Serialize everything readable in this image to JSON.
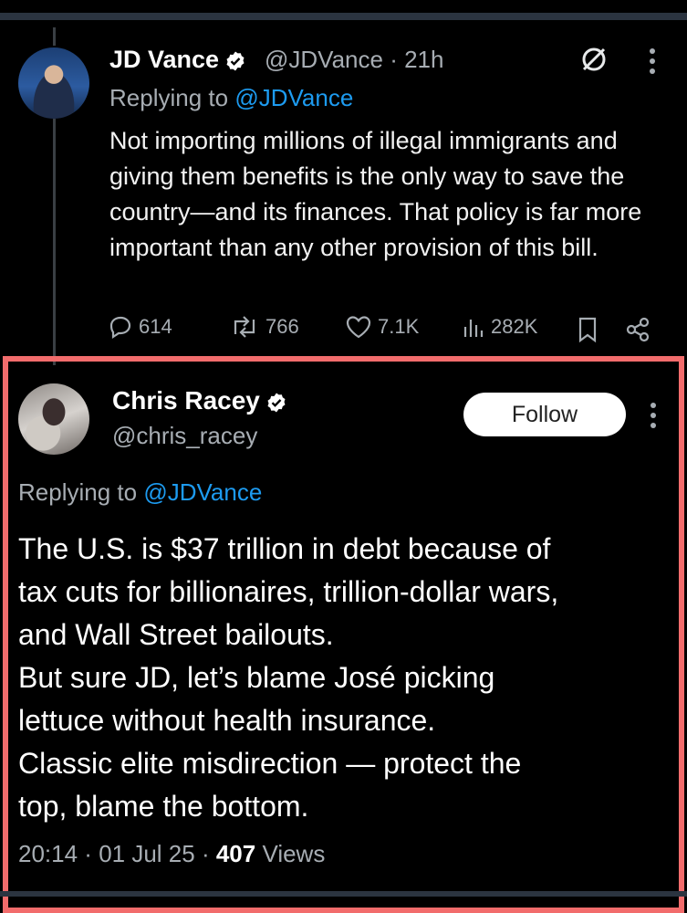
{
  "tweet1": {
    "name": "JD Vance",
    "handle": "@JDVance",
    "separator": " · ",
    "time": "21h",
    "replying_prefix": "Replying to ",
    "replying_to": "@JDVance",
    "text": "Not importing millions of illegal immigrants and giving them benefits is the only way to save the country—and its finances. That policy is far more important than any other provision of this bill.",
    "stats": {
      "replies": "614",
      "reposts": "766",
      "likes": "7.1K",
      "views": "282K"
    }
  },
  "tweet2": {
    "name": "Chris Racey",
    "handle": "@chris_racey",
    "follow_label": "Follow",
    "replying_prefix": "Replying to ",
    "replying_to": "@JDVance",
    "lines": [
      "The U.S. is $37 trillion in debt because of",
      "tax cuts for billionaires, trillion-dollar wars,",
      "and Wall Street bailouts.",
      "But sure JD, let’s blame José picking",
      "lettuce without health insurance.",
      "Classic elite misdirection — protect the",
      "top, blame the bottom."
    ],
    "time": "20:14",
    "date": "01 Jul 25",
    "views_count": "407",
    "views_label": "Views"
  },
  "icons": {
    "verified": "verified-badge-icon",
    "grok": "no-symbol-icon",
    "more": "more-vertical-icon",
    "reply": "reply-icon",
    "repost": "repost-icon",
    "like": "heart-icon",
    "views": "views-chart-icon",
    "bookmark": "bookmark-icon",
    "share": "share-icon"
  },
  "colors": {
    "background": "#000000",
    "mention": "#1d9bf0",
    "highlight_frame": "#f26c6c",
    "muted_text": "#a7adb3"
  }
}
